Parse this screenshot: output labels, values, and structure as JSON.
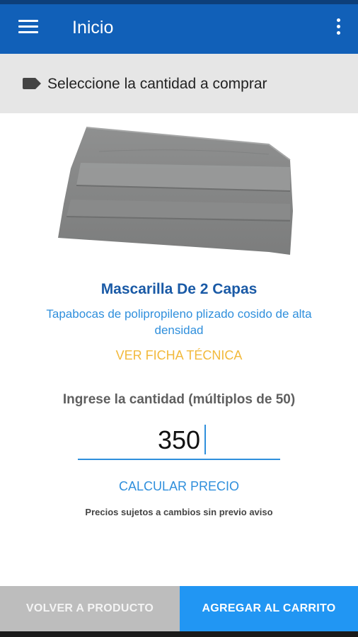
{
  "appbar": {
    "title": "Inicio",
    "menu_icon": "hamburger-menu-icon",
    "more_icon": "more-vertical-icon",
    "color": "#1160b8"
  },
  "banner": {
    "icon": "tag-icon",
    "text": "Seleccione la cantidad a comprar"
  },
  "product": {
    "image": "face-mask-image",
    "name": "Mascarilla De 2 Capas",
    "description": "Tapabocas de polipropileno plizado cosido de alta densidad",
    "tech_sheet_link": "VER FICHA TÉCNICA"
  },
  "quantity": {
    "label": "Ingrese la cantidad (múltiplos de 50)",
    "value": "350",
    "calculate_label": "CALCULAR PRECIO",
    "disclaimer": "Precios sujetos a cambios sin previo aviso"
  },
  "actions": {
    "back_label": "VOLVER A PRODUCTO",
    "cart_label": "AGREGAR AL CARRITO",
    "cart_color": "#2196f3",
    "back_color": "#bdbdbd"
  }
}
